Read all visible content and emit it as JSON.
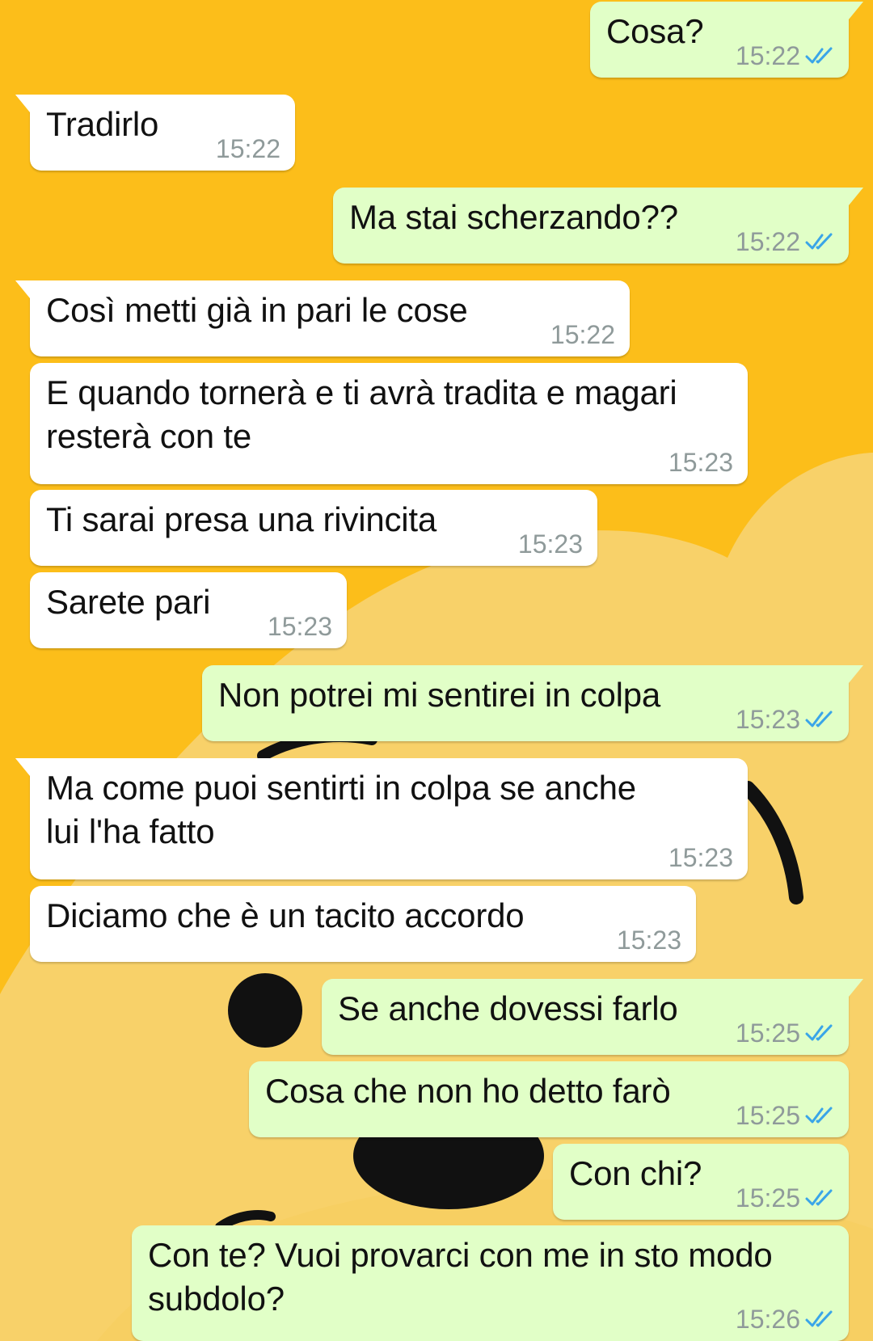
{
  "theme": {
    "wallpaper_color": "#fcbe1a",
    "incoming_bubble": "#ffffff",
    "outgoing_bubble": "#e1ffc7",
    "timestamp_color": "#8f9a9a",
    "read_tick_color": "#3aa5e8"
  },
  "messages": [
    {
      "dir": "out",
      "text": "Cosa?",
      "time": "15:22",
      "status": "read-check-icon"
    },
    {
      "dir": "in",
      "text": "Tradirlo",
      "time": "15:22"
    },
    {
      "dir": "out",
      "text": "Ma stai scherzando??",
      "time": "15:22",
      "status": "read-check-icon"
    },
    {
      "dir": "in",
      "text": "Così metti già in pari le cose",
      "time": "15:22"
    },
    {
      "dir": "in",
      "text": "E quando tornerà e ti avrà tradita e magari\nresterà con te",
      "time": "15:23"
    },
    {
      "dir": "in",
      "text": "Ti sarai presa una rivincita",
      "time": "15:23"
    },
    {
      "dir": "in",
      "text": "Sarete pari",
      "time": "15:23"
    },
    {
      "dir": "out",
      "text": "Non potrei mi sentirei in colpa",
      "time": "15:23",
      "status": "read-check-icon"
    },
    {
      "dir": "in",
      "text": "Ma come puoi sentirti in colpa se anche\nlui l'ha fatto",
      "time": "15:23"
    },
    {
      "dir": "in",
      "text": "Diciamo che è un tacito accordo",
      "time": "15:23"
    },
    {
      "dir": "out",
      "text": "Se anche dovessi farlo",
      "time": "15:25",
      "status": "read-check-icon"
    },
    {
      "dir": "out",
      "text": "Cosa che non ho detto farò",
      "time": "15:25",
      "status": "read-check-icon"
    },
    {
      "dir": "out",
      "text": "Con chi?",
      "time": "15:25",
      "status": "read-check-icon"
    },
    {
      "dir": "out",
      "text": "Con te? Vuoi provarci con me in sto modo\nsubdolo?",
      "time": "15:26",
      "status": "read-check-icon"
    }
  ]
}
